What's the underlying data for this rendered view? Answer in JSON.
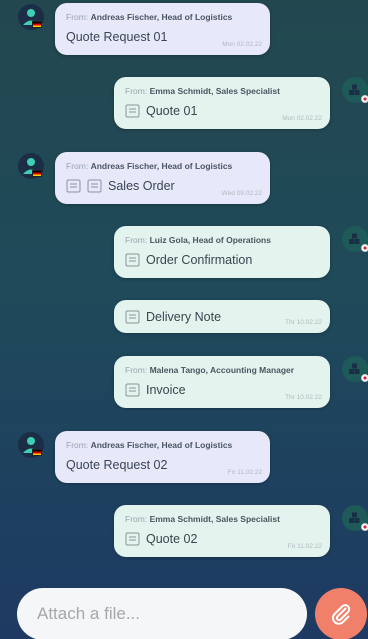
{
  "messages": [
    {
      "direction": "in",
      "from_prefix": "From:",
      "sender": "Andreas Fischer, Head of Logistics",
      "title": "Quote Request  01",
      "icons": 0,
      "date": "Mon 02.02.22"
    },
    {
      "direction": "out",
      "from_prefix": "From:",
      "sender": "Emma Schmidt, Sales Specialist",
      "title": "Quote 01",
      "icons": 1,
      "date": "Mon 02.02.22"
    },
    {
      "direction": "in",
      "from_prefix": "From:",
      "sender": "Andreas Fischer, Head of Logistics",
      "title": "Sales Order",
      "icons": 2,
      "date": "Wed 09.02.22"
    },
    {
      "direction": "out",
      "from_prefix": "From:",
      "sender": "Luiz Gola, Head of Operations",
      "title": "Order Confirmation",
      "icons": 1,
      "date": ""
    },
    {
      "direction": "out",
      "from_prefix": "",
      "sender": "",
      "title": "Delivery Note",
      "icons": 1,
      "date": "Thr 10.02.22"
    },
    {
      "direction": "out",
      "from_prefix": "From:",
      "sender": "Malena Tango, Accounting Manager",
      "title": "Invoice",
      "icons": 1,
      "date": "Thr 10.02.22"
    },
    {
      "direction": "in",
      "from_prefix": "From:",
      "sender": "Andreas Fischer, Head of Logistics",
      "title": "Quote Request  02",
      "icons": 0,
      "date": "Fri 11.02.22"
    },
    {
      "direction": "out",
      "from_prefix": "From:",
      "sender": "Emma Schmidt, Sales Specialist",
      "title": "Quote 02",
      "icons": 1,
      "date": "Fri 11.02.22"
    }
  ],
  "composer": {
    "placeholder": "Attach a file...",
    "attach_icon": "paperclip-icon"
  },
  "icons": {
    "person_avatar": "person-avatar-icon",
    "company_avatar": "company-avatar-icon",
    "document": "document-icon"
  },
  "colors": {
    "incoming_bubble": "#e7e9fa",
    "outgoing_bubble": "#e3f4ee",
    "attach_button": "#f0806a",
    "avatar_accent": "#3ecfb5"
  }
}
